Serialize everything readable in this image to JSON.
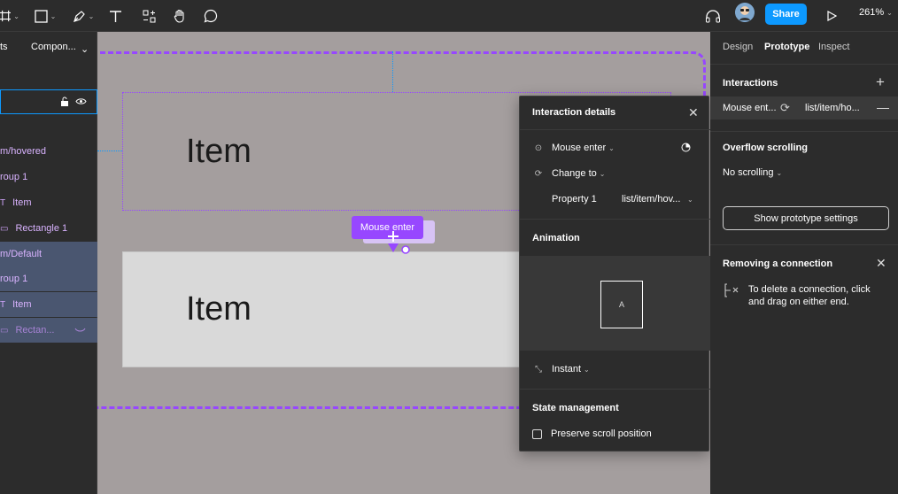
{
  "toolbar": {
    "share_label": "Share",
    "zoom_label": "261%",
    "chevron": "⌄"
  },
  "left_panel": {
    "tabs": [
      "ts",
      "Compon..."
    ],
    "layers": [
      {
        "label": "m/hovered",
        "icon": "",
        "selected": false
      },
      {
        "label": "roup 1",
        "icon": "",
        "selected": false
      },
      {
        "label": "Item",
        "icon": "T",
        "selected": false
      },
      {
        "label": "Rectangle 1",
        "icon": "▭",
        "selected": false
      },
      {
        "label": "m/Default",
        "icon": "",
        "selected": true
      },
      {
        "label": "roup 1",
        "icon": "",
        "selected": true
      },
      {
        "label": "Item",
        "icon": "T",
        "selected": true
      },
      {
        "label": "Rectan...",
        "icon": "▭",
        "selected": true
      }
    ]
  },
  "canvas": {
    "item_top_label": "Item",
    "item_bottom_label": "Item",
    "trigger_tag": "Mouse enter"
  },
  "popup": {
    "title": "Interaction details",
    "trigger": "Mouse enter",
    "action": "Change to",
    "property_name": "Property 1",
    "property_value": "list/item/hov...",
    "animation_heading": "Animation",
    "preview_letter": "A",
    "transition": "Instant",
    "state_heading": "State management",
    "preserve_label": "Preserve scroll position"
  },
  "right_panel": {
    "tabs": {
      "design": "Design",
      "prototype": "Prototype",
      "inspect": "Inspect"
    },
    "interactions_heading": "Interactions",
    "interaction_trigger": "Mouse ent...",
    "interaction_target": "list/item/ho...",
    "overflow_heading": "Overflow scrolling",
    "overflow_value": "No scrolling",
    "proto_settings_label": "Show prototype settings",
    "removing_heading": "Removing a connection",
    "removing_text_1": "To delete a connection, click",
    "removing_text_2": "and drag on either end."
  },
  "colors": {
    "accent": "#0d99ff",
    "prototype_purple": "#9747ff",
    "canvas_bg": "#a49e9e",
    "panel_bg": "#2c2c2c"
  }
}
